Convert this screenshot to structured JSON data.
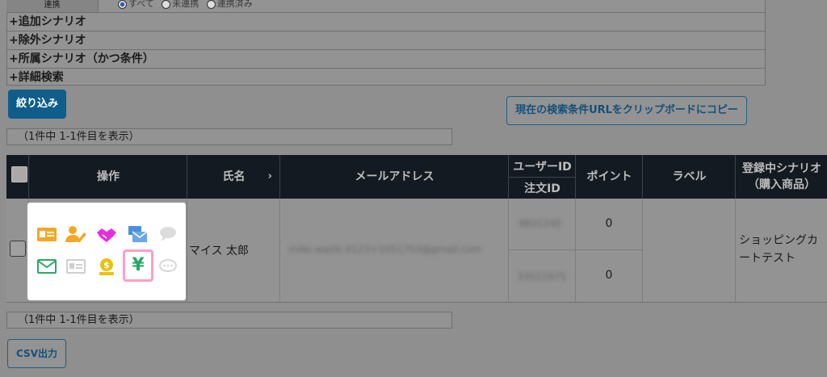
{
  "filters": {
    "top_label": "連携",
    "radio_options": [
      "すべて",
      "未連携",
      "連携済み"
    ],
    "rows": [
      "+追加シナリオ",
      "+除外シナリオ",
      "+所属シナリオ（かつ条件）",
      "+詳細検索"
    ]
  },
  "buttons": {
    "narrow": "絞り込み",
    "copy_url": "現在の検索条件URLをクリップボードにコピー",
    "csv": "CSV出力"
  },
  "result_count_top": "（1件中 1-1件目を表示）",
  "result_count_bottom": "（1件中 1-1件目を表示）",
  "table": {
    "headers": {
      "actions": "操作",
      "name": "氏名",
      "name_sort": "›",
      "email": "メールアドレス",
      "user_id": "ユーザーID",
      "order_id": "注文ID",
      "points": "ポイント",
      "label": "ラベル",
      "scenario_line1": "登録中シナリオ",
      "scenario_line2": "（購入商品）"
    },
    "row": {
      "name": "マイス 太郎",
      "email": "mike.wazle.0123+1051753@gmail.com",
      "user_id": "9831245",
      "order_id": "33521975",
      "points_1": "0",
      "points_2": "0",
      "scenario": "ショッピングカートテスト"
    }
  },
  "operation_icons": [
    "id-card-icon",
    "user-edit-icon",
    "handshake-icon",
    "mail-stack-icon",
    "chat-bubble-icon",
    "envelope-icon",
    "card-disabled-icon",
    "money-bag-icon",
    "yen-icon",
    "chat-dots-icon"
  ],
  "operation_yen_symbol": "¥",
  "colors": {
    "orange": "#f5a623",
    "magenta": "#e62ee0",
    "blue": "#4a90d9",
    "green": "#2aa86a",
    "gold": "#e8c20c",
    "highlight": "#ff9ec5",
    "header_bg": "#141a21"
  }
}
